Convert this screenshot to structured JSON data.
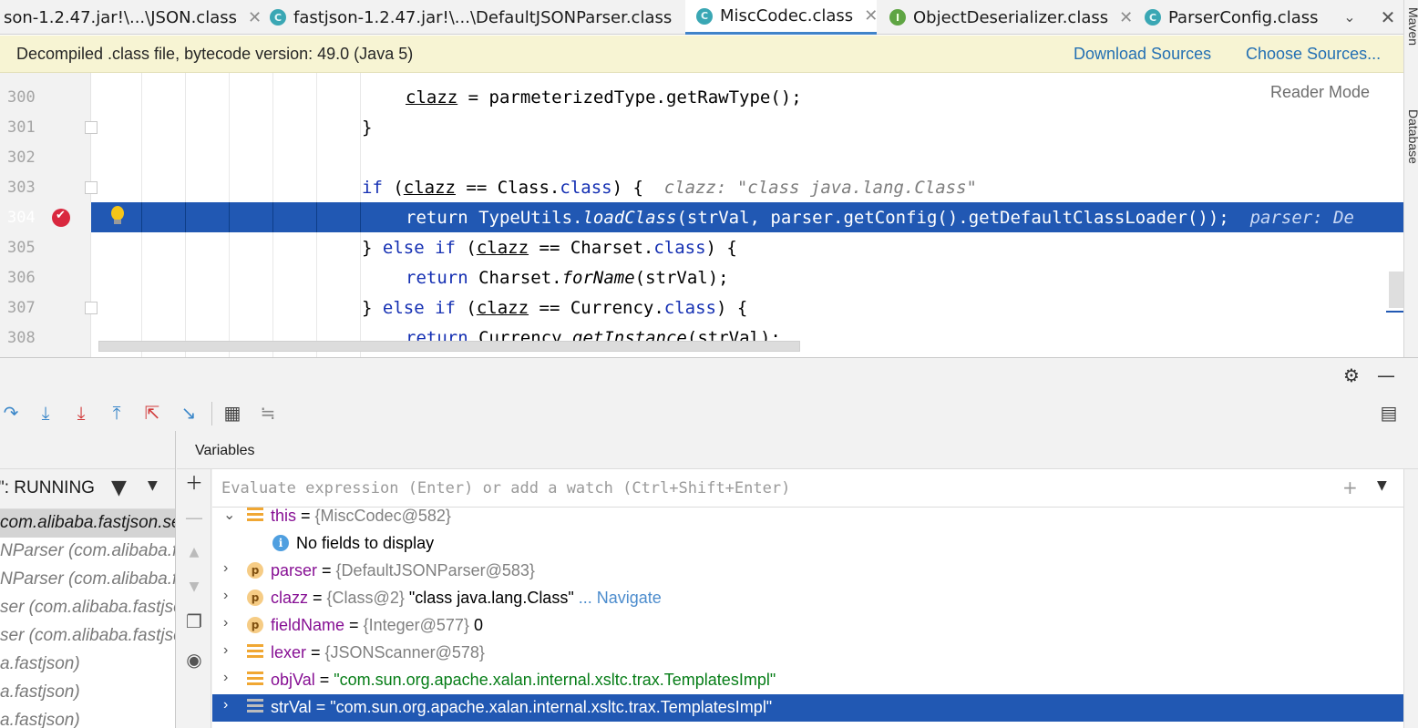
{
  "tabs": [
    {
      "label": "son-1.2.47.jar!\\...\\JSON.class",
      "icon": "class-icon",
      "letter": "C",
      "active": false,
      "closable": true
    },
    {
      "label": "fastjson-1.2.47.jar!\\...\\DefaultJSONParser.class",
      "icon": "class-icon",
      "letter": "C",
      "active": false,
      "closable": true
    },
    {
      "label": "MiscCodec.class",
      "icon": "class-icon",
      "letter": "C",
      "active": true,
      "closable": true
    },
    {
      "label": "ObjectDeserializer.class",
      "icon": "interface-icon",
      "letter": "I",
      "active": false,
      "closable": true
    },
    {
      "label": "ParserConfig.class",
      "icon": "class-icon",
      "letter": "C",
      "active": false,
      "closable": false
    }
  ],
  "tab_close_symbol": "✕",
  "tab_more_symbol": "⌄",
  "right_strip": {
    "top_label": "Maven",
    "bottom_label": "Database"
  },
  "banner": {
    "text": "Decompiled .class file, bytecode version: 49.0 (Java 5)",
    "download_sources": "Download Sources",
    "choose_sources": "Choose Sources..."
  },
  "editor": {
    "reader_mode": "Reader Mode",
    "lines": [
      {
        "num": "300",
        "parts": [
          [
            "",
            "clazz"
          ],
          [
            "u",
            ""
          ],
          [
            "",
            " = parmeterizedType.getRawType();"
          ]
        ]
      },
      {
        "num": "301",
        "parts": [
          [
            "",
            "}"
          ]
        ]
      },
      {
        "num": "302",
        "parts": []
      },
      {
        "num": "303",
        "parts": [
          [
            "k",
            "if"
          ],
          [
            "",
            " ("
          ],
          [
            "u",
            "clazz"
          ],
          [
            "",
            " == Class."
          ],
          [
            "k",
            "class"
          ],
          [
            "",
            ") {  "
          ],
          [
            "h",
            "clazz: \"class java.lang.Class\""
          ]
        ]
      },
      {
        "num": "304",
        "parts": [
          [
            "k",
            "return"
          ],
          [
            "",
            " TypeUtils."
          ],
          [
            "i",
            "loadClass"
          ],
          [
            "",
            "(strVal, parser.getConfig().getDefaultClassLoader());  "
          ],
          [
            "h",
            "parser: De"
          ]
        ]
      },
      {
        "num": "305",
        "parts": [
          [
            "",
            "} "
          ],
          [
            "k",
            "else if"
          ],
          [
            "",
            " ("
          ],
          [
            "u",
            "clazz"
          ],
          [
            "",
            " == Charset."
          ],
          [
            "k",
            "class"
          ],
          [
            "",
            ") {"
          ]
        ]
      },
      {
        "num": "306",
        "parts": [
          [
            "k",
            "return"
          ],
          [
            "",
            " Charset."
          ],
          [
            "i",
            "forName"
          ],
          [
            "",
            "(strVal);"
          ]
        ]
      },
      {
        "num": "307",
        "parts": [
          [
            "",
            "} "
          ],
          [
            "k",
            "else if"
          ],
          [
            "",
            " ("
          ],
          [
            "u",
            "clazz"
          ],
          [
            "",
            " == Currency."
          ],
          [
            "k",
            "class"
          ],
          [
            "",
            ") {"
          ]
        ]
      },
      {
        "num": "308",
        "parts": [
          [
            "k",
            "return"
          ],
          [
            "",
            " Currency."
          ],
          [
            "i",
            "getInstance"
          ],
          [
            "",
            "(strVal);"
          ]
        ]
      }
    ]
  },
  "debug": {
    "settings_icon": "gear-icon",
    "minimize_icon": "minimize-icon",
    "toolbar": [
      {
        "name": "step-over-icon",
        "glyph": "↷"
      },
      {
        "name": "step-into-icon",
        "glyph": "⤓"
      },
      {
        "name": "force-step-into-icon",
        "glyph": "⤓"
      },
      {
        "name": "step-out-icon",
        "glyph": "⤒"
      },
      {
        "name": "drop-frame-icon",
        "glyph": "⇱"
      },
      {
        "name": "run-to-cursor-icon",
        "glyph": "↘"
      },
      {
        "name": "evaluate-expression-icon",
        "glyph": "▦"
      },
      {
        "name": "trace-current-stream-icon",
        "glyph": "≒"
      }
    ],
    "layout_icon": "layout-icon",
    "thread_label": "\": RUNNING",
    "frames": [
      {
        "text": "com.alibaba.fastjson.ser",
        "selected": true
      },
      {
        "text": "NParser (com.alibaba.f",
        "selected": false
      },
      {
        "text": "NParser (com.alibaba.f",
        "selected": false
      },
      {
        "text": "ser (com.alibaba.fastjsc",
        "selected": false
      },
      {
        "text": "ser (com.alibaba.fastjsc",
        "selected": false
      },
      {
        "text": "a.fastjson)",
        "selected": false
      },
      {
        "text": "a.fastjson)",
        "selected": false
      },
      {
        "text": "a.fastjson)",
        "selected": false
      }
    ],
    "variables_title": "Variables",
    "eval_placeholder": "Evaluate expression (Enter) or add a watch (Ctrl+Shift+Enter)",
    "variables": [
      {
        "arrow": "⌄",
        "icon": "field",
        "indent": 0,
        "name": "this",
        "ref": "{MiscCodec@582}",
        "value": "",
        "value_type": "",
        "nav": "",
        "selected": false
      },
      {
        "arrow": "",
        "icon": "info",
        "indent": 1,
        "name": "",
        "ref": "",
        "value": "No fields to display",
        "value_type": "plain",
        "nav": "",
        "selected": false
      },
      {
        "arrow": "›",
        "icon": "param",
        "indent": 0,
        "name": "parser",
        "ref": "{DefaultJSONParser@583}",
        "value": "",
        "value_type": "",
        "nav": "",
        "selected": false
      },
      {
        "arrow": "›",
        "icon": "param",
        "indent": 0,
        "name": "clazz",
        "ref": "{Class@2}",
        "value": "\"class java.lang.Class\"",
        "value_type": "plain",
        "nav": "... Navigate",
        "selected": false
      },
      {
        "arrow": "›",
        "icon": "param",
        "indent": 0,
        "name": "fieldName",
        "ref": "{Integer@577}",
        "value": "0",
        "value_type": "plain",
        "nav": "",
        "selected": false
      },
      {
        "arrow": "›",
        "icon": "field",
        "indent": 0,
        "name": "lexer",
        "ref": "{JSONScanner@578}",
        "value": "",
        "value_type": "",
        "nav": "",
        "selected": false
      },
      {
        "arrow": "›",
        "icon": "field",
        "indent": 0,
        "name": "objVal",
        "ref": "",
        "value": "\"com.sun.org.apache.xalan.internal.xsltc.trax.TemplatesImpl\"",
        "value_type": "str",
        "nav": "",
        "selected": false
      },
      {
        "arrow": "›",
        "icon": "field",
        "indent": 0,
        "name": "strVal",
        "ref": "",
        "value": "\"com.sun.org.apache.xalan.internal.xsltc.trax.TemplatesImpl\"",
        "value_type": "str",
        "nav": "",
        "selected": true
      }
    ]
  },
  "colors": {
    "accent": "#2158b3",
    "keyword": "#1530b3",
    "string": "#067d17",
    "var_name": "#871094",
    "link": "#2470b3",
    "banner_bg": "#f7f4d3"
  }
}
